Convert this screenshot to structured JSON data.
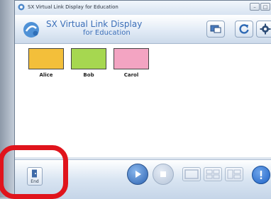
{
  "window": {
    "title": "SX Virtual Link Display for Education"
  },
  "header": {
    "app_name": "SX Virtual Link Display",
    "app_sub": "for Education"
  },
  "toolbar": {
    "icons": [
      "display-icon",
      "refresh-icon",
      "gear-icon"
    ]
  },
  "users": [
    {
      "name": "Alice",
      "color": "#f3bf3a"
    },
    {
      "name": "Bob",
      "color": "#a6d750"
    },
    {
      "name": "Carol",
      "color": "#f3a4c2"
    }
  ],
  "footer": {
    "end_label": "End"
  },
  "colors": {
    "accent": "#3c6fb8",
    "highlight": "#e0141c",
    "alert": "#1f63c7"
  }
}
